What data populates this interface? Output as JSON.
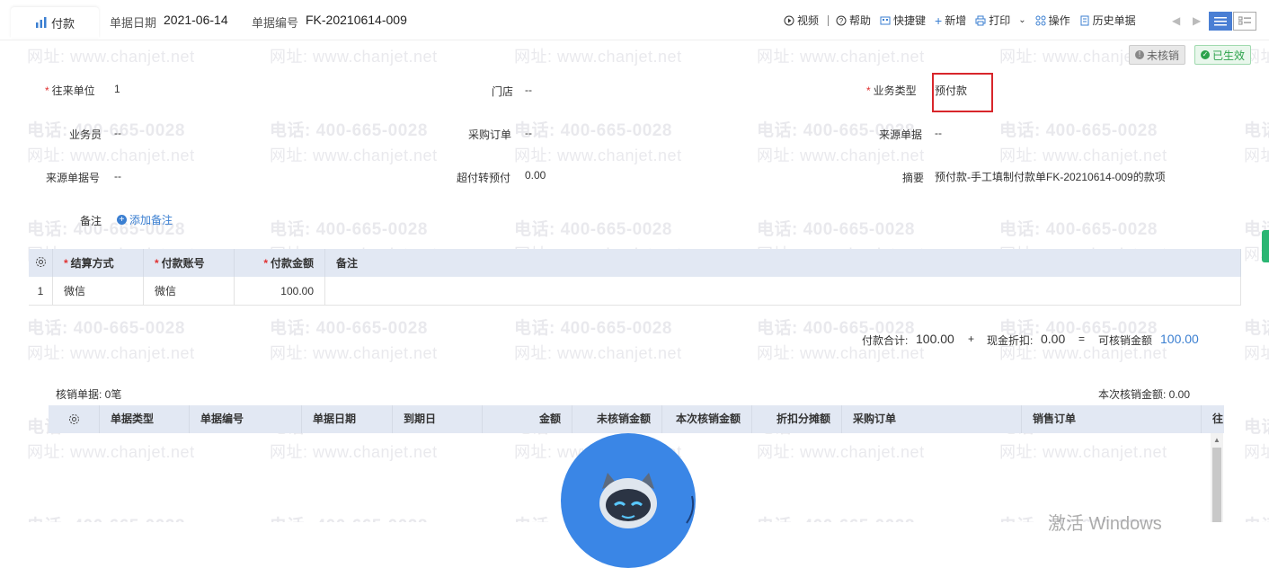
{
  "header": {
    "tab_label": "付款",
    "date_label": "单据日期",
    "date_value": "2021-06-14",
    "number_label": "单据编号",
    "number_value": "FK-20210614-009"
  },
  "toolbar": {
    "video": "视频",
    "help": "帮助",
    "shortcut": "快捷键",
    "add": "新增",
    "print": "打印",
    "operate": "操作",
    "history": "历史单据"
  },
  "badges": {
    "unverified": "未核销",
    "effective": "已生效"
  },
  "form": {
    "counterparty_label": "往来单位",
    "counterparty_value": "1",
    "store_label": "门店",
    "store_value": "--",
    "biz_type_label": "业务类型",
    "biz_type_value": "预付款",
    "salesman_label": "业务员",
    "salesman_value": "--",
    "po_label": "采购订单",
    "po_value": "--",
    "source_doc_label": "来源单据",
    "source_doc_value": "--",
    "source_no_label": "来源单据号",
    "source_no_value": "--",
    "overpay_label": "超付转预付",
    "overpay_value": "0.00",
    "summary_label": "摘要",
    "summary_value": "预付款-手工填制付款单FK-20210614-009的款项",
    "note_label": "备注",
    "add_note": "添加备注"
  },
  "payment_table": {
    "headers": [
      "结算方式",
      "付款账号",
      "付款金额",
      "备注"
    ],
    "rows": [
      {
        "idx": "1",
        "method": "微信",
        "account": "微信",
        "amount": "100.00",
        "note": ""
      }
    ]
  },
  "totals": {
    "pay_total_label": "付款合计:",
    "pay_total_value": "100.00",
    "plus": "+",
    "discount_label": "现金折扣:",
    "discount_value": "0.00",
    "equals": "=",
    "verifiable_label": "可核销金额",
    "verifiable_value": "100.00"
  },
  "verify": {
    "count_label": "核销单据: 0笔",
    "current_label": "本次核销金额: 0.00",
    "headers": [
      "单据类型",
      "单据编号",
      "单据日期",
      "到期日",
      "金额",
      "未核销金额",
      "本次核销金额",
      "折扣分摊额",
      "采购订单",
      "销售订单",
      "往"
    ]
  },
  "watermark": {
    "phone": "电话: 400-665-0028",
    "site": "网址: www.chanjet.net"
  },
  "os_overlay": "激活 Windows",
  "colors": {
    "accent": "#3b7fd1",
    "required": "#e03030",
    "success": "#2ca24b",
    "header_bg": "#e2e8f3",
    "highlight_box": "#d8262b"
  }
}
